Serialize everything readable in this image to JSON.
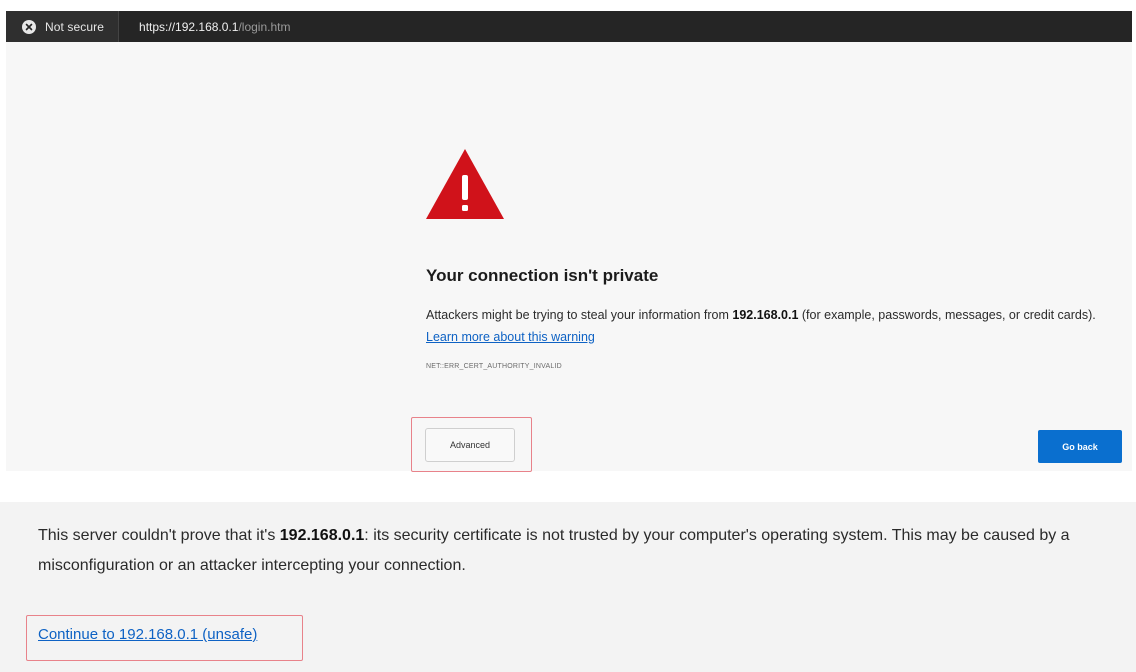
{
  "addressbar": {
    "security_label": "Not secure",
    "url_host": "https://192.168.0.1",
    "url_path": "/login.htm"
  },
  "warning": {
    "title": "Your connection isn't private",
    "desc_prefix": "Attackers might be trying to steal your information from ",
    "host": "192.168.0.1",
    "desc_suffix": " (for example, passwords, messages, or credit cards). ",
    "learn_more": "Learn more about this warning",
    "error_code": "NET::ERR_CERT_AUTHORITY_INVALID",
    "advanced_label": "Advanced",
    "go_back_label": "Go back"
  },
  "detail": {
    "line1_prefix": "This server couldn't prove that it's ",
    "host": "192.168.0.1",
    "line1_suffix": ": its security certificate is not trusted by your computer's operating system. This may be caused by a misconfiguration or an attacker intercepting your connection.",
    "continue_label": "Continue to 192.168.0.1 (unsafe)"
  },
  "colors": {
    "warning_red": "#d0121a",
    "link_blue": "#0e62c4",
    "primary_button": "#0a6fcf",
    "highlight_border": "#e8828a"
  },
  "icons": {
    "security": "close-circle-icon",
    "warning": "warning-triangle-icon"
  }
}
